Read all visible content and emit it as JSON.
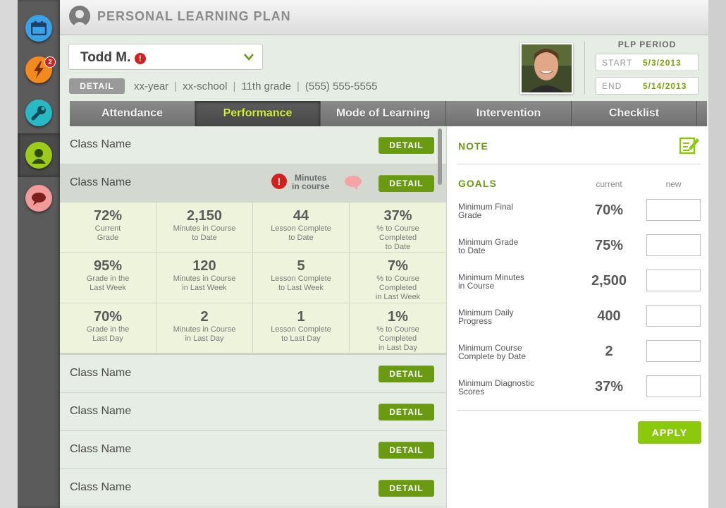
{
  "app": {
    "title": "PERSONAL LEARNING PLAN"
  },
  "rail": {
    "badge_count": "2",
    "colors": {
      "calendar": "#3aa3e8",
      "bolt": "#f28a1e",
      "tools": "#27b9c6",
      "profile": "#9ccb1a",
      "chat": "#f39a9a"
    }
  },
  "student": {
    "name": "Todd M.",
    "alert": "!",
    "detail_label": "DETAIL",
    "year": "xx-year",
    "school": "xx-school",
    "grade": "11th grade",
    "phone": "(555) 555-5555"
  },
  "plp": {
    "label": "PLP PERIOD",
    "start_label": "START",
    "start_value": "5/3/2013",
    "end_label": "END",
    "end_value": "5/14/2013"
  },
  "tabs": [
    {
      "label": "Attendance"
    },
    {
      "label": "Performance"
    },
    {
      "label": "Mode of Learning"
    },
    {
      "label": "Intervention"
    },
    {
      "label": "Checklist"
    }
  ],
  "classes": {
    "detail_label": "DETAIL",
    "rows": [
      {
        "name": "Class Name"
      },
      {
        "name": "Class Name"
      },
      {
        "name": "Class Name"
      },
      {
        "name": "Class Name"
      },
      {
        "name": "Class Name"
      },
      {
        "name": "Class Name"
      }
    ],
    "selected_alert_line1": "Minutes",
    "selected_alert_line2": "in course",
    "alert_glyph": "!"
  },
  "stats": [
    {
      "value": "72%",
      "l1": "Current",
      "l2": "Grade",
      "l3": ""
    },
    {
      "value": "2,150",
      "l1": "Minutes in Course",
      "l2": "to Date",
      "l3": ""
    },
    {
      "value": "44",
      "l1": "Lesson Complete",
      "l2": "to Date",
      "l3": ""
    },
    {
      "value": "37%",
      "l1": "% to Course",
      "l2": "Completed",
      "l3": "to Date"
    },
    {
      "value": "95%",
      "l1": "Grade in the",
      "l2": "Last Week",
      "l3": ""
    },
    {
      "value": "120",
      "l1": "Minutes in Course",
      "l2": "in Last Week",
      "l3": ""
    },
    {
      "value": "5",
      "l1": "Lesson Complete",
      "l2": "to Last Week",
      "l3": ""
    },
    {
      "value": "7%",
      "l1": "% to Course",
      "l2": "Completed",
      "l3": "in Last Week"
    },
    {
      "value": "70%",
      "l1": "Grade in the",
      "l2": "Last Day",
      "l3": ""
    },
    {
      "value": "2",
      "l1": "Minutes in Course",
      "l2": "in Last Day",
      "l3": ""
    },
    {
      "value": "1",
      "l1": "Lesson Complete",
      "l2": "to Last Day",
      "l3": ""
    },
    {
      "value": "1%",
      "l1": "% to Course",
      "l2": "Completed",
      "l3": "in Last Day"
    }
  ],
  "panel": {
    "note_title": "NOTE",
    "goals_title": "GOALS",
    "col_current": "current",
    "col_new": "new",
    "goals": [
      {
        "l1": "Minimum Final",
        "l2": "Grade",
        "current": "70%",
        "new": ""
      },
      {
        "l1": "Minimum Grade",
        "l2": "to Date",
        "current": "75%",
        "new": ""
      },
      {
        "l1": "Minimum Minutes",
        "l2": "in Course",
        "current": "2,500",
        "new": ""
      },
      {
        "l1": "Minimum Daily",
        "l2": "Progress",
        "current": "400",
        "new": ""
      },
      {
        "l1": "Minimum Course",
        "l2": "Complete by Date",
        "current": "2",
        "new": ""
      },
      {
        "l1": "Minimum Diagnostic",
        "l2": "Scores",
        "current": "37%",
        "new": ""
      }
    ],
    "apply_label": "APPLY"
  }
}
